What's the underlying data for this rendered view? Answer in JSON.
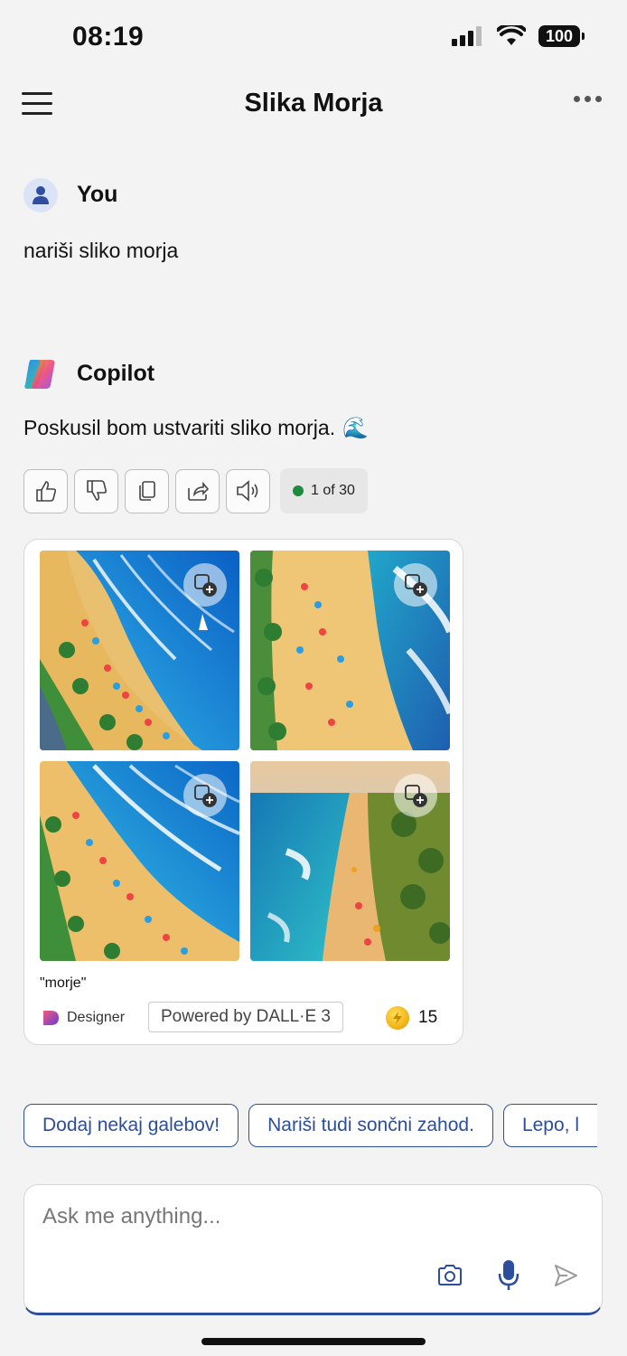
{
  "status_bar": {
    "time": "08:19",
    "battery": "100"
  },
  "header": {
    "title": "Slika Morja"
  },
  "user": {
    "name": "You",
    "message": "nariši sliko morja"
  },
  "copilot": {
    "name": "Copilot",
    "message": "Poskusil bom ustvariti sliko morja.",
    "emoji": "🌊",
    "counter": "1 of 30"
  },
  "image_card": {
    "caption": "\"morje\"",
    "designer_label": "Designer",
    "powered_by": "Powered by DALL·E 3",
    "credits": "15"
  },
  "suggestions": [
    "Dodaj nekaj galebov!",
    "Nariši tudi sončni zahod.",
    "Lepo, l"
  ],
  "input": {
    "placeholder": "Ask me anything..."
  },
  "colors": {
    "accent": "#2d4e9a",
    "status_green": "#1e8a3c",
    "background": "#f3f3f3"
  }
}
